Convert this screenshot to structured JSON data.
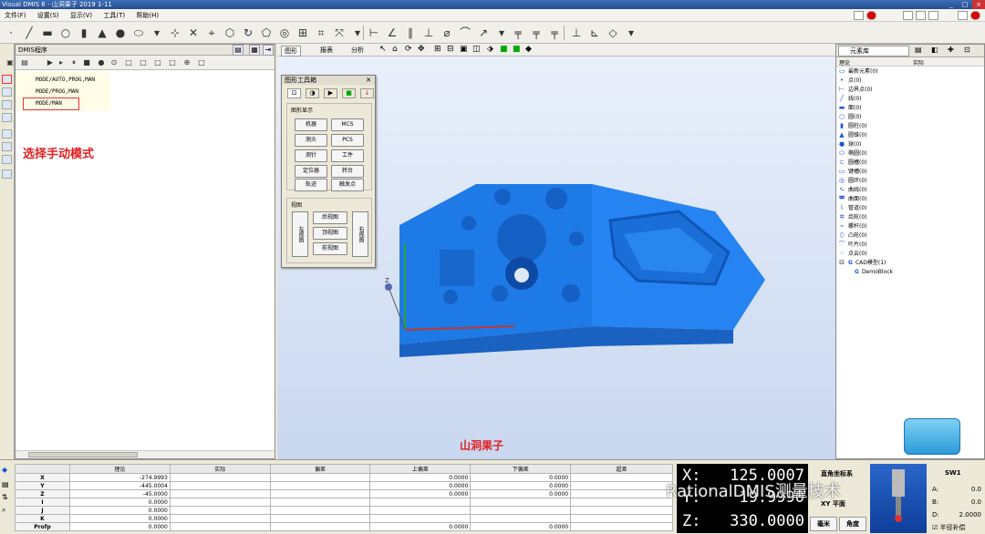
{
  "window": {
    "title": "Visual DMIS 6 - 山洞果子  2019  1-11"
  },
  "menu": [
    "文件(F)",
    "设置(S)",
    "显示(V)",
    "工具(T)",
    "帮助(H)"
  ],
  "dmis_panel": {
    "title": "DMIS程序",
    "lines": [
      "MODE/AUTO,PROG,MAN",
      "MODE/PROG,MAN",
      "MODE/MAN"
    ],
    "annotation": "选择手动模式"
  },
  "view_tabs": [
    "图形",
    "报表",
    "分析"
  ],
  "graphics_toolbox": {
    "title": "图形工具箱",
    "section_display": "图形显示",
    "buttons": [
      "机器",
      "MCS",
      "测头",
      "PCS",
      "测针",
      "工件",
      "定位器",
      "转台",
      "轨迹",
      "触发点"
    ],
    "section_view": "视图",
    "view_left": "左视图",
    "view_right": "右视图",
    "view_buttons": [
      "后视图",
      "顶视图",
      "前视图"
    ]
  },
  "viewport": {
    "caption": "山洞果子",
    "axis_z": "Z"
  },
  "element_panel": {
    "tab": "元素库",
    "col_theory": "理论",
    "col_actual": "实际",
    "items": [
      {
        "icon": "folder-icon",
        "label": "最新元素(0)"
      },
      {
        "icon": "point-icon",
        "label": "点(0)"
      },
      {
        "icon": "edge-point-icon",
        "label": "边界点(0)"
      },
      {
        "icon": "line-icon",
        "label": "线(0)"
      },
      {
        "icon": "plane-icon",
        "label": "面(0)"
      },
      {
        "icon": "circle-icon",
        "label": "圆(0)"
      },
      {
        "icon": "cylinder-icon",
        "label": "圆柱(0)"
      },
      {
        "icon": "cone-icon",
        "label": "圆锥(0)"
      },
      {
        "icon": "sphere-icon",
        "label": "球(0)"
      },
      {
        "icon": "ellipse-icon",
        "label": "椭圆(0)"
      },
      {
        "icon": "slot-icon",
        "label": "圆槽(0)"
      },
      {
        "icon": "keyway-icon",
        "label": "键槽(0)"
      },
      {
        "icon": "torus-icon",
        "label": "圆环(0)"
      },
      {
        "icon": "curve-icon",
        "label": "曲线(0)"
      },
      {
        "icon": "surface-icon",
        "label": "曲面(0)"
      },
      {
        "icon": "pipe-icon",
        "label": "管道(0)"
      },
      {
        "icon": "gear-icon",
        "label": "齿轮(0)"
      },
      {
        "icon": "screw-icon",
        "label": "螺杆(0)"
      },
      {
        "icon": "cam-icon",
        "label": "凸轮(0)"
      },
      {
        "icon": "blade-icon",
        "label": "叶片(0)"
      },
      {
        "icon": "point-cloud-icon",
        "label": "点云(0)"
      },
      {
        "icon": "cad-icon",
        "label": "CAD模型(1)"
      },
      {
        "icon": "cad-item-icon",
        "label": "DemoBlock"
      }
    ]
  },
  "results": {
    "headers": [
      "理论",
      "实际",
      "偏差",
      "上偏差",
      "下偏差",
      "超差"
    ],
    "rows": [
      {
        "label": "X",
        "theory": "-274.9993",
        "actual": "",
        "dev": "",
        "up": "0.0000",
        "low": "0.0000",
        "over": ""
      },
      {
        "label": "Y",
        "theory": "-445.0004",
        "actual": "",
        "dev": "",
        "up": "0.0000",
        "low": "0.0000",
        "over": ""
      },
      {
        "label": "Z",
        "theory": "-45.0000",
        "actual": "",
        "dev": "",
        "up": "0.0000",
        "low": "0.0000",
        "over": ""
      },
      {
        "label": "I",
        "theory": "0.0000",
        "actual": "",
        "dev": "",
        "up": "",
        "low": "",
        "over": ""
      },
      {
        "label": "J",
        "theory": "0.0000",
        "actual": "",
        "dev": "",
        "up": "",
        "low": "",
        "over": ""
      },
      {
        "label": "K",
        "theory": "0.0000",
        "actual": "",
        "dev": "",
        "up": "",
        "low": "",
        "over": ""
      },
      {
        "label": "Profp",
        "theory": "0.0000",
        "actual": "",
        "dev": "",
        "up": "0.0000",
        "low": "0.0000",
        "over": ""
      }
    ]
  },
  "coords": {
    "x_label": "X:",
    "x_value": "125.0007",
    "y_label": "Y:",
    "y_value": "19.9990",
    "z_label": "Z:",
    "z_value": "330.0000"
  },
  "coord_options": {
    "system": "直角坐标系",
    "plane": "XY 平面",
    "unit": "毫米",
    "angle": "角度"
  },
  "probe": {
    "name": "SW1",
    "a_label": "A:",
    "a_value": "0.0",
    "b_label": "B:",
    "b_value": "0.0",
    "d_label": "D:",
    "d_value": "2.0000",
    "comp": "半径补偿"
  },
  "watermark": "RationalDMIS测量技术",
  "colors": {
    "part": "#1e7ae6",
    "viewport_top": "#e9f0fb",
    "viewport_bottom": "#c9d7ef",
    "annotation_red": "#e02020"
  }
}
